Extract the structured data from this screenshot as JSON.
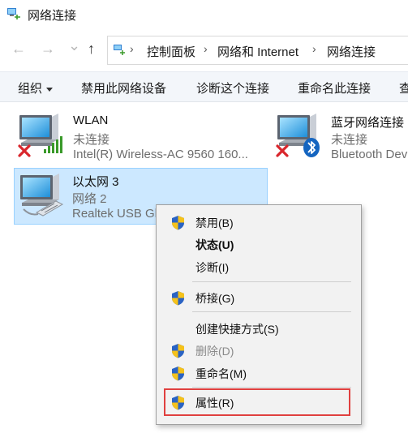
{
  "window": {
    "title": "网络连接"
  },
  "nav": {
    "back_glyph": "←",
    "forward_glyph": "→",
    "down_glyph": "⌄",
    "up_glyph": "↑"
  },
  "breadcrumb": [
    "控制面板",
    "网络和 Internet",
    "网络连接"
  ],
  "toolbar": {
    "organize": "组织",
    "disable": "禁用此网络设备",
    "diagnose": "诊断这个连接",
    "rename": "重命名此连接",
    "overflow": "查"
  },
  "adapters": [
    {
      "name": "WLAN",
      "status": "未连接",
      "device": "Intel(R) Wireless-AC 9560 160...",
      "icon": "wifi-adapter-icon"
    },
    {
      "name": "蓝牙网络连接",
      "status": "未连接",
      "device": "Bluetooth Dev",
      "icon": "bluetooth-adapter-icon"
    },
    {
      "name": "以太网 3",
      "status": "网络 2",
      "device": "Realtek USB Gb",
      "icon": "ethernet-adapter-icon"
    }
  ],
  "context_menu": {
    "items": [
      {
        "label": "禁用(B)",
        "shield": true
      },
      {
        "label": "状态(U)",
        "bold": true
      },
      {
        "label": "诊断(I)"
      },
      {
        "label": "桥接(G)",
        "shield": true
      },
      {
        "label": "创建快捷方式(S)"
      },
      {
        "label": "删除(D)",
        "shield": true,
        "disabled": true
      },
      {
        "label": "重命名(M)",
        "shield": true
      },
      {
        "label": "属性(R)",
        "shield": true,
        "highlighted": true
      }
    ]
  },
  "colors": {
    "selection": "#cce8ff",
    "highlight_border": "#e0403f",
    "error_x": "#d9262c",
    "signal_green": "#3a9a2a"
  }
}
